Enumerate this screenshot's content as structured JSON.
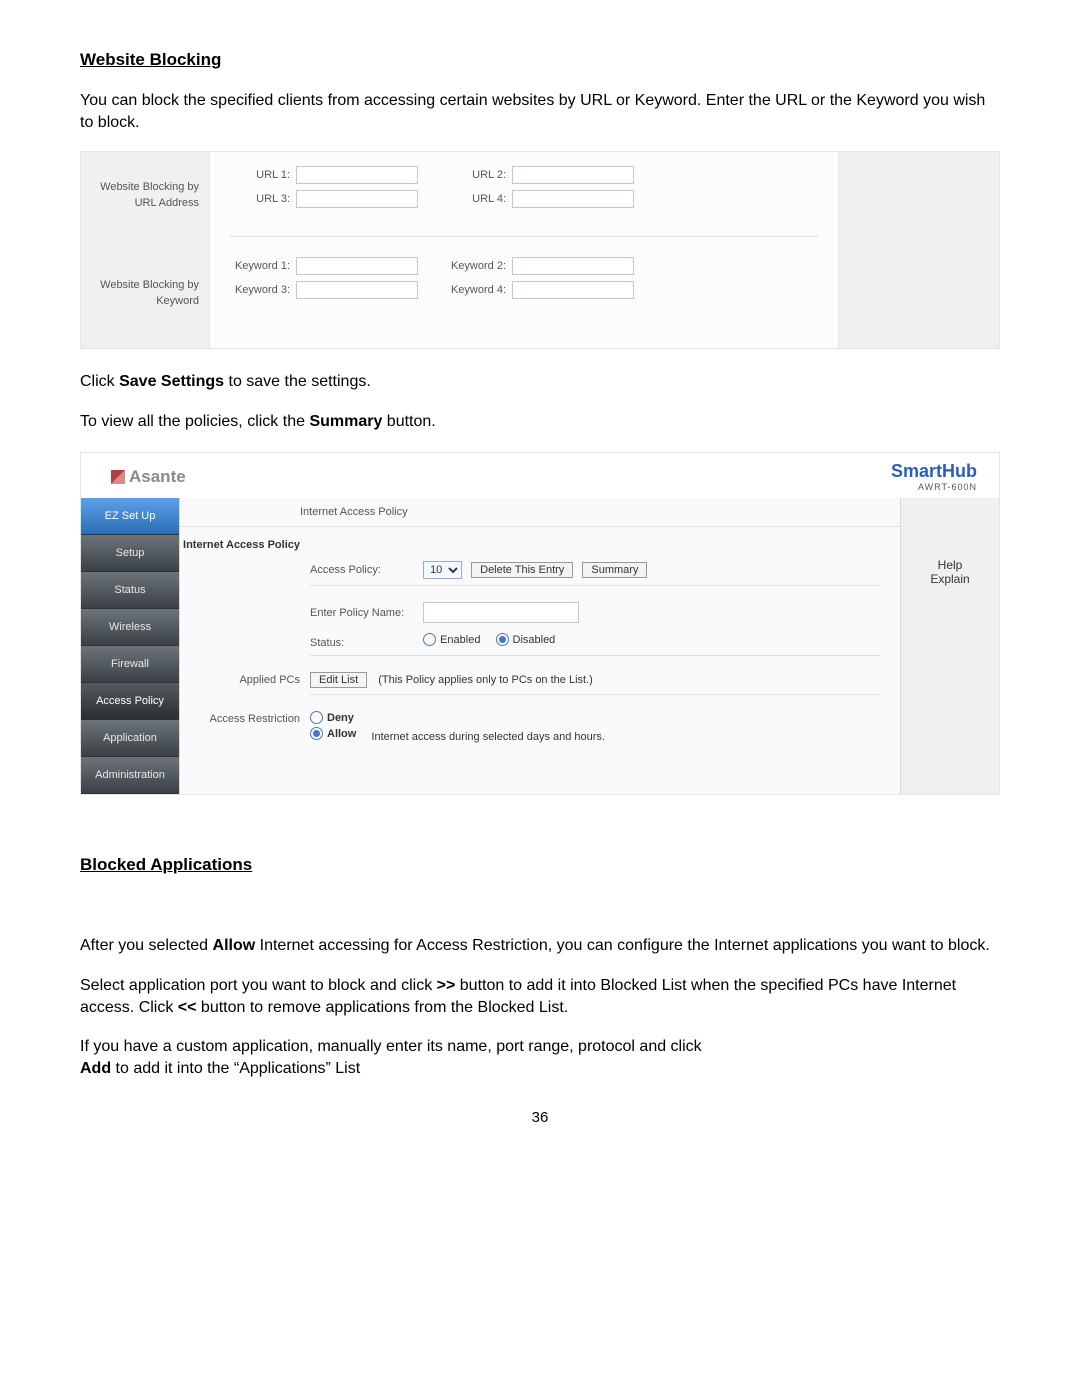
{
  "headings": {
    "website_blocking": "Website Blocking",
    "blocked_applications": "Blocked Applications"
  },
  "paras": {
    "intro": "You can block the specified clients from accessing certain websites by URL or Keyword. Enter the URL or the Keyword you wish to block.",
    "save_pre": "Click ",
    "save_bold": "Save Settings",
    "save_post": " to save the settings.",
    "summary_pre": "To view all the policies, click the ",
    "summary_bold": "Summary",
    "summary_post": " button.",
    "ba1_pre": "After you selected ",
    "ba1_bold": "Allow",
    "ba1_post": " Internet accessing for Access Restriction, you can configure the Internet applications you want to block.",
    "ba2_pre": "Select application port you want to block and click ",
    "ba2_b1": ">>",
    "ba2_mid": " button to add it into Blocked List when the specified PCs have Internet access. Click ",
    "ba2_b2": "<<",
    "ba2_post": " button to remove applications from the Blocked List.",
    "ba3_pre": "If you have a custom application, manually enter its name, port range, protocol and click",
    "ba3_bold": "Add",
    "ba3_post": " to add it into the “Applications” List"
  },
  "shot1": {
    "by_url_label": "Website Blocking by URL Address",
    "by_keyword_label": "Website Blocking by Keyword",
    "url1": "URL 1:",
    "url2": "URL 2:",
    "url3": "URL 3:",
    "url4": "URL 4:",
    "kw1": "Keyword 1:",
    "kw2": "Keyword 2:",
    "kw3": "Keyword 3:",
    "kw4": "Keyword 4:"
  },
  "shot2": {
    "brand_left": "Asante",
    "brand_right_title": "SmartHub",
    "brand_right_sub": "AWRT-600N",
    "nav": {
      "ez": "EZ Set Up",
      "setup": "Setup",
      "status": "Status",
      "wireless": "Wireless",
      "firewall": "Firewall",
      "access": "Access Policy",
      "application": "Application",
      "admin": "Administration"
    },
    "tab_title": "Internet Access Policy",
    "section_iap": "Internet Access Policy",
    "access_policy_label": "Access Policy:",
    "access_policy_value": "10",
    "btn_delete": "Delete This Entry",
    "btn_summary": "Summary",
    "policy_name_label": "Enter Policy Name:",
    "status_label": "Status:",
    "status_enabled": "Enabled",
    "status_disabled": "Disabled",
    "applied_pcs_label": "Applied PCs",
    "btn_editlist": "Edit List",
    "applied_pcs_note": "(This Policy applies only to PCs on the List.)",
    "access_restriction_label": "Access Restriction",
    "deny": "Deny",
    "allow": "Allow",
    "allow_suffix": "Internet access during selected days and hours.",
    "help_line1": "Help",
    "help_line2": "Explain"
  },
  "page_number": "36"
}
